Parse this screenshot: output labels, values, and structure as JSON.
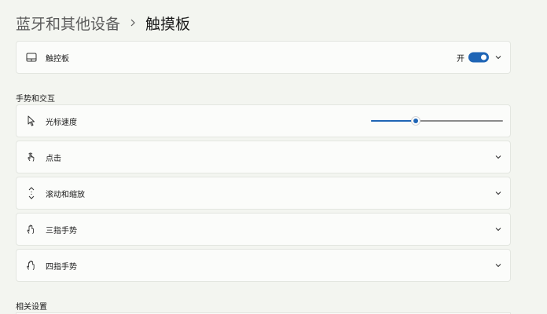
{
  "breadcrumb": {
    "parent": "蓝牙和其他设备",
    "current": "触摸板"
  },
  "touchpad_card": {
    "label": "触控板",
    "toggle_state_text": "开",
    "toggle_on": true
  },
  "gestures_section": {
    "title": "手势和交互",
    "items": [
      {
        "label": "光标速度",
        "icon": "cursor-icon",
        "control": "slider",
        "value": 0.34
      },
      {
        "label": "点击",
        "icon": "tap-icon",
        "control": "expand"
      },
      {
        "label": "滚动和缩放",
        "icon": "scroll-icon",
        "control": "expand"
      },
      {
        "label": "三指手势",
        "icon": "three-finger-icon",
        "control": "expand"
      },
      {
        "label": "四指手势",
        "icon": "four-finger-icon",
        "control": "expand"
      }
    ]
  },
  "related_section": {
    "title": "相关设置"
  },
  "colors": {
    "accent": "#1f65b5",
    "background": "#f3f5f0",
    "card": "#fbfcfa"
  }
}
